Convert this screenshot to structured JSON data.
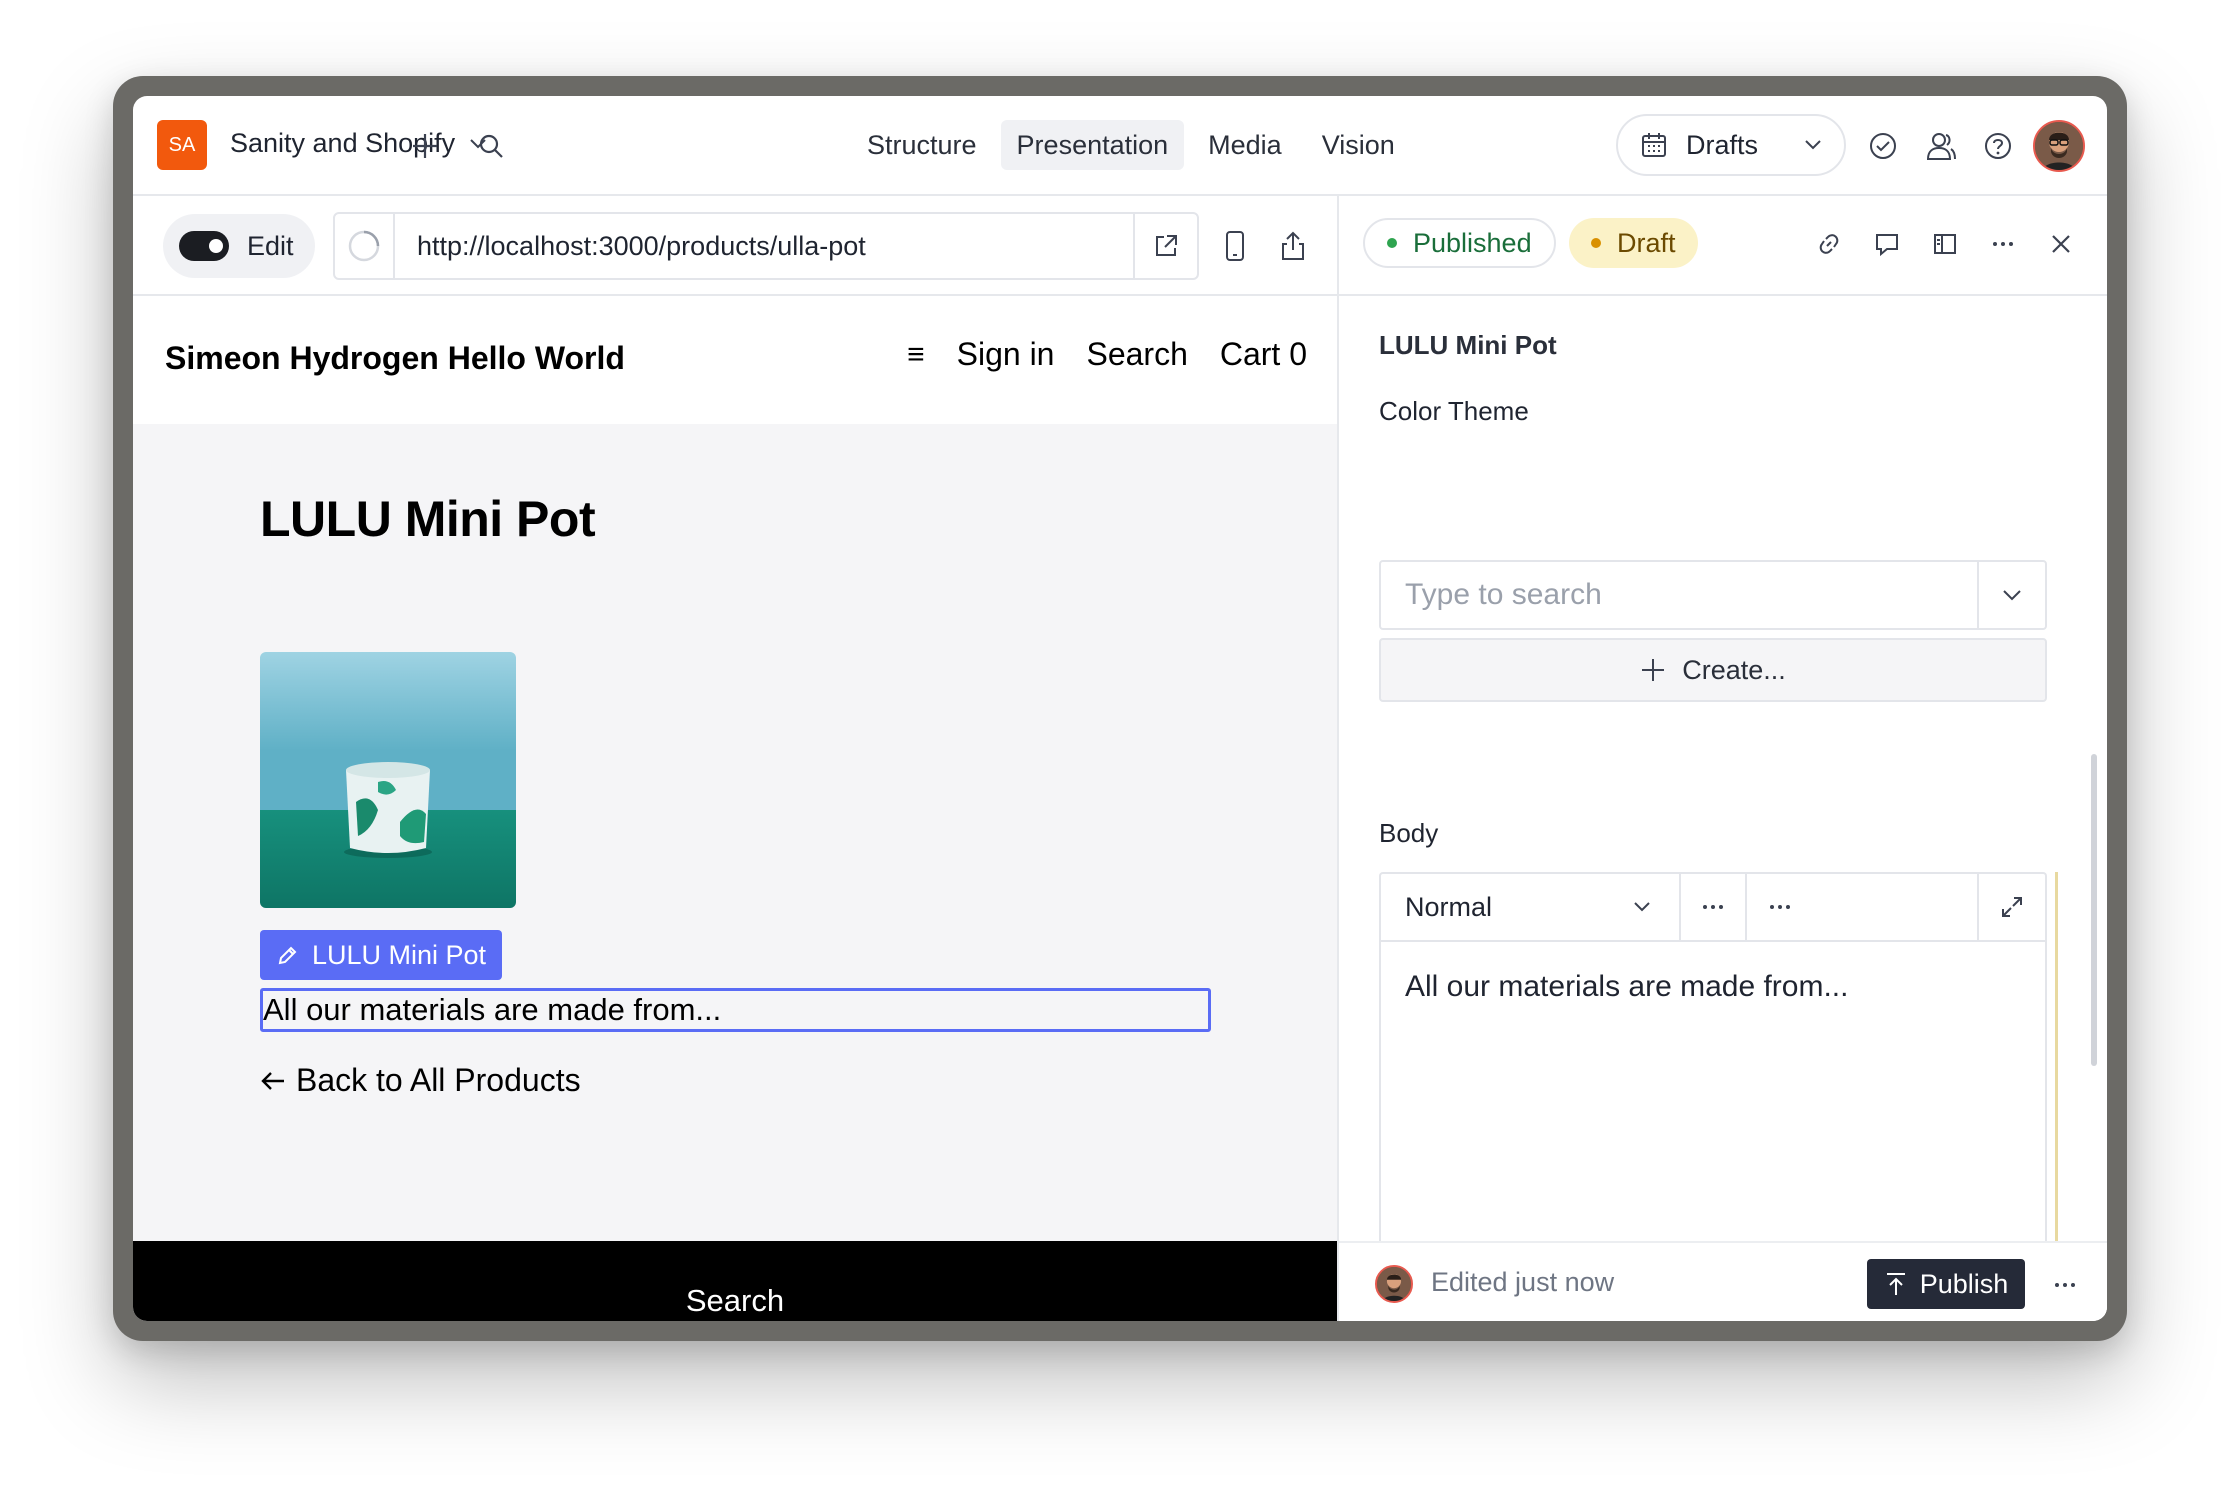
{
  "workspace": {
    "badge": "SA",
    "name": "Sanity and Shopify"
  },
  "nav": {
    "items": [
      "Structure",
      "Presentation",
      "Media",
      "Vision"
    ],
    "active": "Presentation"
  },
  "perspective": {
    "label": "Drafts"
  },
  "preview": {
    "edit_label": "Edit",
    "url": "http://localhost:3000/products/ulla-pot"
  },
  "site": {
    "title": "Simeon Hydrogen Hello World",
    "menu_icon": "≡",
    "sign_in": "Sign in",
    "search": "Search",
    "cart": "Cart 0",
    "product_title": "LULU Mini Pot",
    "overlay_label": "LULU Mini Pot",
    "description": "All our materials are made from...",
    "back_link": "Back to All Products",
    "footer_search": "Search"
  },
  "document": {
    "published_label": "Published",
    "draft_label": "Draft",
    "title": "LULU Mini Pot",
    "color_theme_label": "Color Theme",
    "search_placeholder": "Type to search",
    "create_label": "Create...",
    "body_label": "Body",
    "style_value": "Normal",
    "body_text": "All our materials are made from...",
    "status_text": "Edited just now",
    "publish_label": "Publish"
  },
  "colors": {
    "workspace_badge": "#f2590d",
    "overlay_accent": "#5a6cf5",
    "published_dot": "#2ea44f",
    "draft_dot": "#d99000",
    "publish_button": "#252a38"
  }
}
